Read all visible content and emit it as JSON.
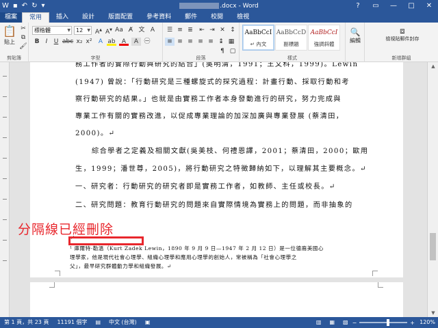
{
  "window": {
    "title_suffix": ".docx - Word",
    "controls": [
      "?",
      "▭",
      "—",
      "□",
      "✕"
    ]
  },
  "quick_access": {
    "save_icon": "save-icon",
    "undo_icon": "undo-icon",
    "redo_icon": "redo-icon"
  },
  "tabs": [
    "檔案",
    "常用",
    "插入",
    "設計",
    "版面配置",
    "參考資料",
    "郵件",
    "校閱",
    "檢視"
  ],
  "ribbon": {
    "paste_label": "貼上",
    "clipboard_group": "剪貼簿",
    "font_name": "標楷體",
    "font_size": "12",
    "font_group": "字型",
    "paragraph_group": "段落",
    "styles_group": "樣式",
    "styles": [
      {
        "sample": "AaBbCcI",
        "name": "↵ 內文"
      },
      {
        "sample": "AaBbCcD",
        "name": "副標題"
      },
      {
        "sample": "AaBbCcI",
        "name": "強調斜體"
      }
    ],
    "editing_label": "編輯",
    "addin_label": "檢視貼郵件封存",
    "addin_group": "新增群組"
  },
  "document": {
    "lines": [
      "務工作者的實際行動與研究的結合」(吳明清，1991；王文科，1999)。Lewin",
      "(1947) 曾說：「行動研究是三種螺旋式的探究過程：計畫行動、採取行動和考",
      "察行動研究的結果。」也就是由實務工作者本身發動進行的研究，努力完成與",
      "專業工作有關的實務改進，以促成專業理論的加深加廣與專業發展 (蔡清田，",
      "2000)。↵",
      "綜合學者之定義及相關文獻(吳美枝、何禮恩譯，2001；蔡清田，2000；歐用",
      "生，1999；潘世尊，2005)，將行動研究之特徵歸納如下，以理解其主要概念。↵",
      "一、研究者：行動研究的研究者即是實務工作者，如教師、主任或校長。↵",
      "二、研究問題：教育行動研究的問題來自實際情境為實務上的問題，而非抽象的"
    ],
    "footnote_mark": "↵",
    "footnote": [
      "¹ 庫爾特·勒溫（Kurt Zadek Lewin，1890 年 9 月 9 日—1947 年 2 月 12 日）是一位德裔美國心",
      "理學家，他是現代社會心理學、組織心理學和應用心理學的創始人，常被稱為「社會心理學之",
      "父」，最早研究群體動力學和組織發展。↵"
    ]
  },
  "annotation": "分隔線已經刪除",
  "status": {
    "page": "第 1 頁，共 23 頁",
    "words": "11191 個字",
    "lang": "中文 (台灣)",
    "zoom": "120%",
    "zoom_minus": "−",
    "zoom_plus": "+"
  }
}
